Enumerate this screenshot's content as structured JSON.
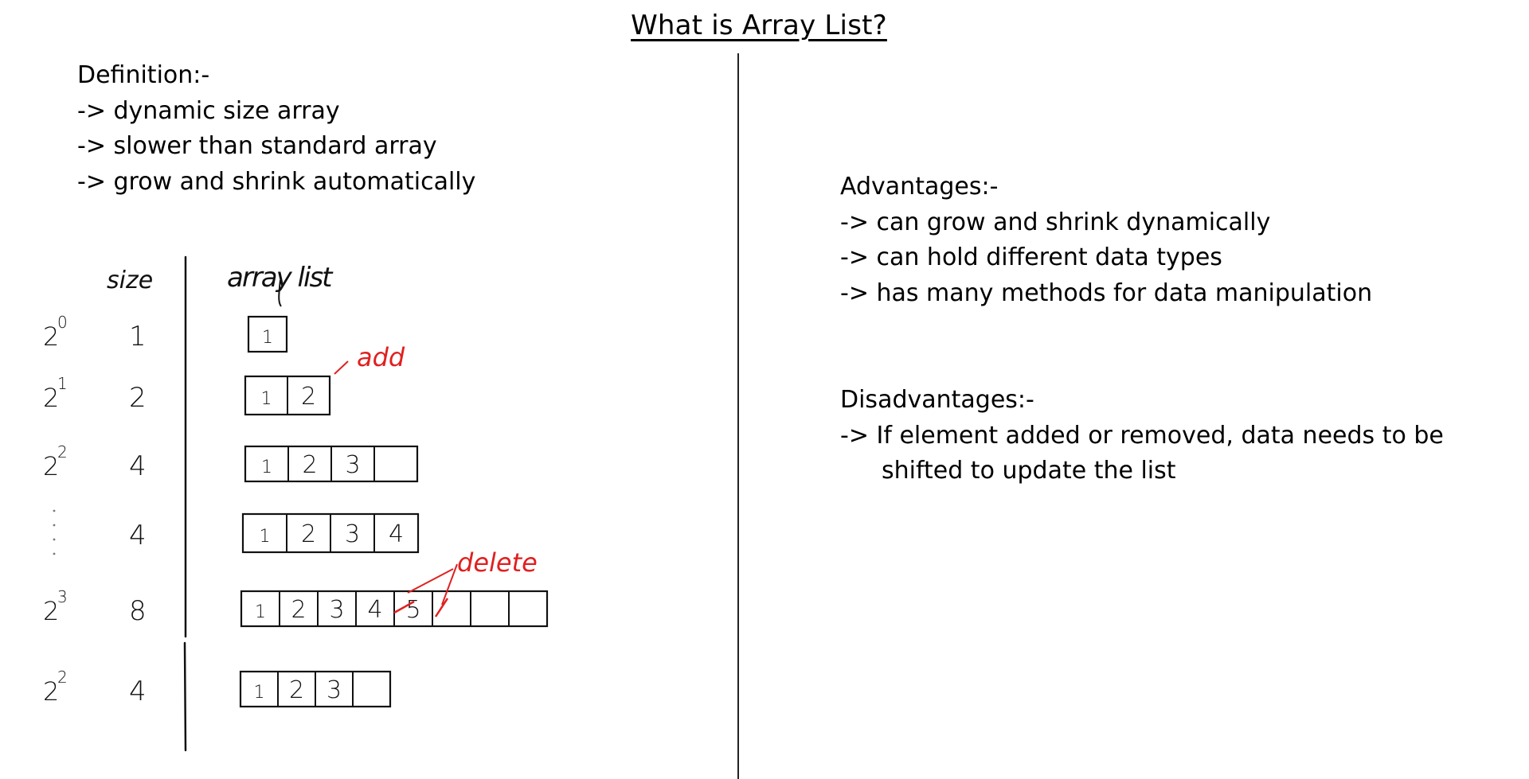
{
  "title": "What is Array List?",
  "definition": {
    "heading": "Definition:-",
    "points": [
      "-> dynamic size array",
      "-> slower than standard array",
      "-> grow and shrink automatically"
    ]
  },
  "advantages": {
    "heading": "Advantages:-",
    "points": [
      "-> can grow and shrink dynamically",
      "-> can hold different data types",
      "-> has many methods for data manipulation"
    ]
  },
  "disadvantages": {
    "heading": "Disadvantages:-",
    "points": [
      "-> If element added or removed, data needs to be",
      "shifted to update the list"
    ]
  },
  "sketch": {
    "size_header": "size",
    "arraylist_header": "array list",
    "rows": [
      {
        "power": "2",
        "exponent": "0",
        "size": "1",
        "capacity": 1,
        "cells": [
          "1"
        ]
      },
      {
        "power": "2",
        "exponent": "1",
        "size": "2",
        "capacity": 2,
        "cells": [
          "1",
          "2"
        ]
      },
      {
        "power": "2",
        "exponent": "2",
        "size": "4",
        "capacity": 4,
        "cells": [
          "1",
          "2",
          "3",
          ""
        ]
      },
      {
        "power": ":",
        "exponent": "",
        "size": "4",
        "capacity": 4,
        "cells": [
          "1",
          "2",
          "3",
          "4"
        ]
      },
      {
        "power": "2",
        "exponent": "3",
        "size": "8",
        "capacity": 8,
        "cells": [
          "1",
          "2",
          "3",
          "4",
          "5",
          "",
          "",
          ""
        ]
      },
      {
        "power": "2",
        "exponent": "2",
        "size": "4",
        "capacity": 4,
        "cells": [
          "1",
          "2",
          "3",
          ""
        ]
      }
    ],
    "add_label": "add",
    "delete_label": "delete",
    "annotation_color": "#e02020",
    "ink_color": "#111111"
  }
}
